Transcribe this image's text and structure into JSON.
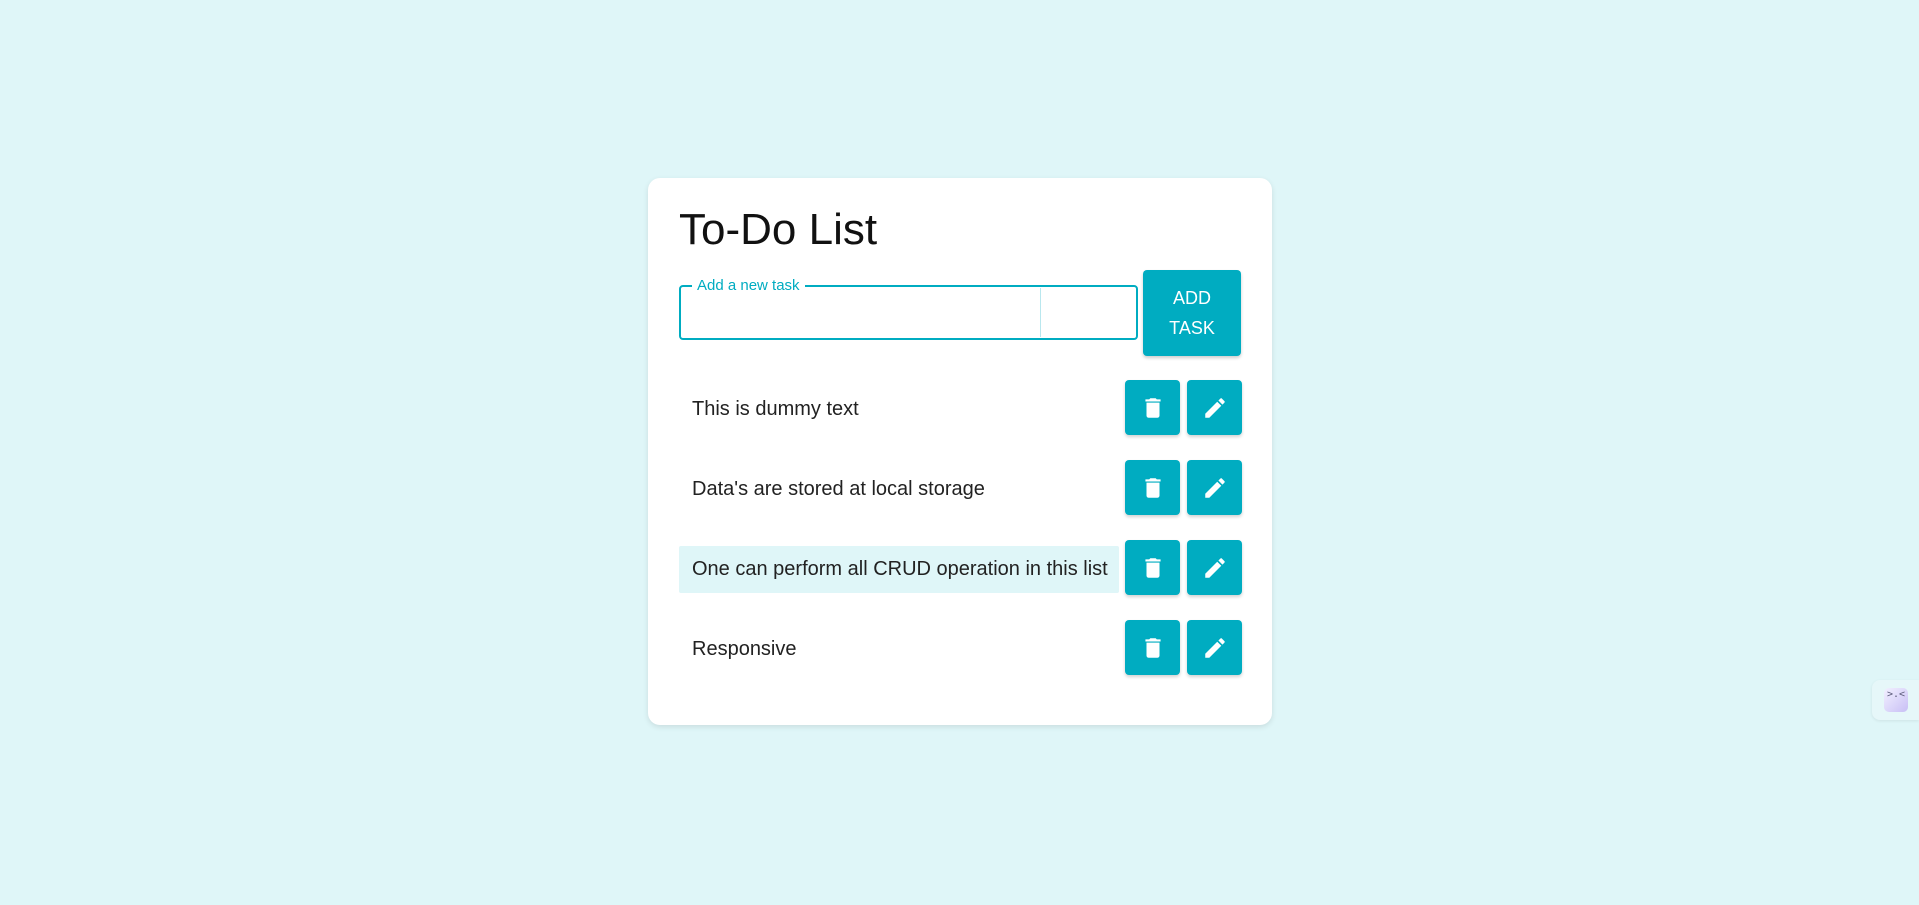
{
  "app": {
    "title": "To-Do List"
  },
  "input": {
    "label": "Add a new task",
    "value": ""
  },
  "add_button": {
    "label": "ADD TASK"
  },
  "tasks": [
    {
      "text": "This is dummy text",
      "highlighted": false
    },
    {
      "text": "Data's are stored at local storage",
      "highlighted": false
    },
    {
      "text": "One can perform all CRUD operation in this list",
      "highlighted": true
    },
    {
      "text": "Responsive",
      "highlighted": false
    }
  ],
  "icons": {
    "delete": "trash-icon",
    "edit": "pencil-icon"
  },
  "widget": {
    "glyph": ">.<"
  },
  "colors": {
    "background": "#dff6f8",
    "accent": "#00acc1",
    "card": "#ffffff",
    "highlight": "#dff6f8"
  }
}
